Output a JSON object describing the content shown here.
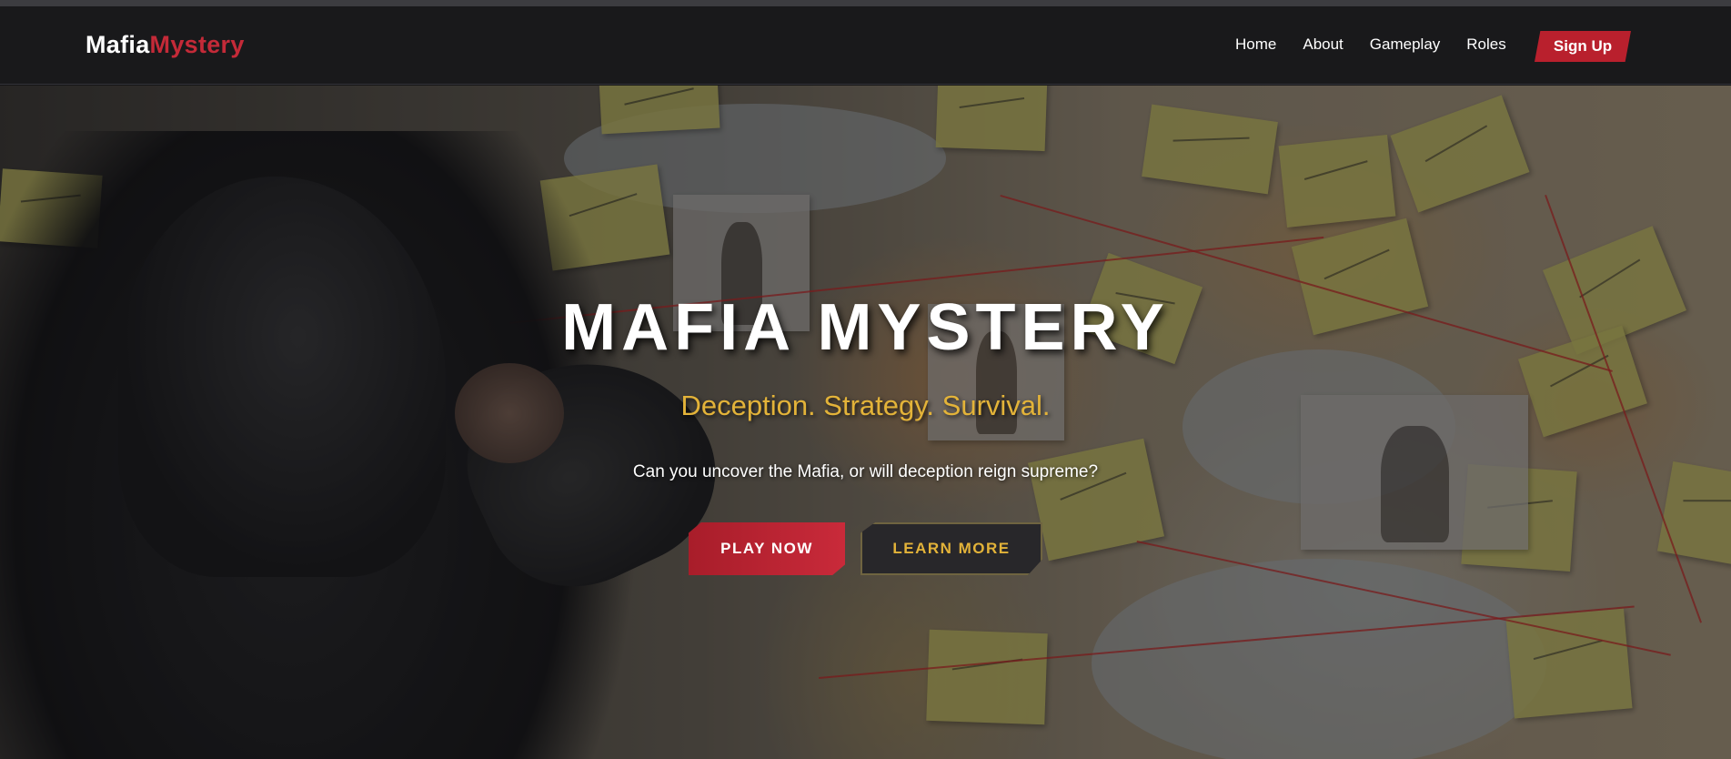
{
  "nav": {
    "logo_part1": "Mafia",
    "logo_part2": "Mystery",
    "links": [
      "Home",
      "About",
      "Gameplay",
      "Roles"
    ],
    "signup_label": "Sign Up"
  },
  "hero": {
    "title": "MAFIA MYSTERY",
    "subtitle": "Deception. Strategy. Survival.",
    "description": "Can you uncover the Mafia, or will deception reign supreme?",
    "play_label": "PLAY NOW",
    "learn_label": "LEARN MORE"
  },
  "colors": {
    "accent_red": "#b9202d",
    "accent_gold": "#e3b339",
    "nav_bg": "#1a1a1c"
  }
}
